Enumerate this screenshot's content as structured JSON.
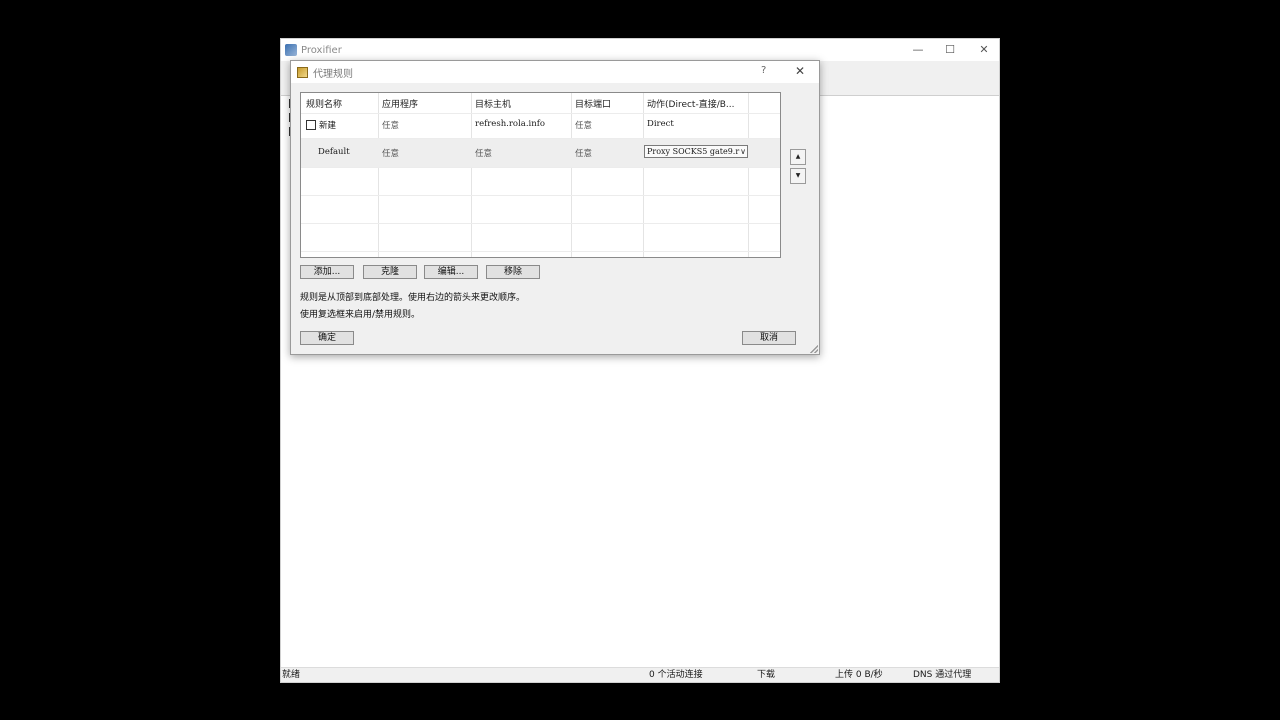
{
  "main_window": {
    "title": "Proxifier",
    "controls": {
      "minimize": "—",
      "maximize": "☐",
      "close": "✕"
    },
    "status_bar": {
      "state": "就绪",
      "connections": "0 个活动连接",
      "download": "下载",
      "upload": "上传 0 B/秒",
      "dns": "DNS 通过代理"
    }
  },
  "dialog": {
    "title": "代理规则",
    "help": "?",
    "close": "✕",
    "table": {
      "headers": [
        "规则名称",
        "应用程序",
        "目标主机",
        "目标端口",
        "动作(Direct-直接/B..."
      ],
      "rows": [
        {
          "name": "新建",
          "app": "任意",
          "host": "refresh.rola.info",
          "port": "任意",
          "action": "Direct",
          "checked": false
        },
        {
          "name": "Default",
          "app": "任意",
          "host": "任意",
          "port": "任意",
          "action": "Proxy SOCKS5 gate9.r"
        }
      ]
    },
    "move_up": "▲",
    "move_down": "▼",
    "buttons": {
      "add": "添加...",
      "clone": "克隆",
      "edit": "编辑...",
      "remove": "移除"
    },
    "note1": "规则是从顶部到底部处理。使用右边的箭头来更改顺序。",
    "note2": "使用复选框来启用/禁用规则。",
    "ok": "确定",
    "cancel": "取消"
  }
}
